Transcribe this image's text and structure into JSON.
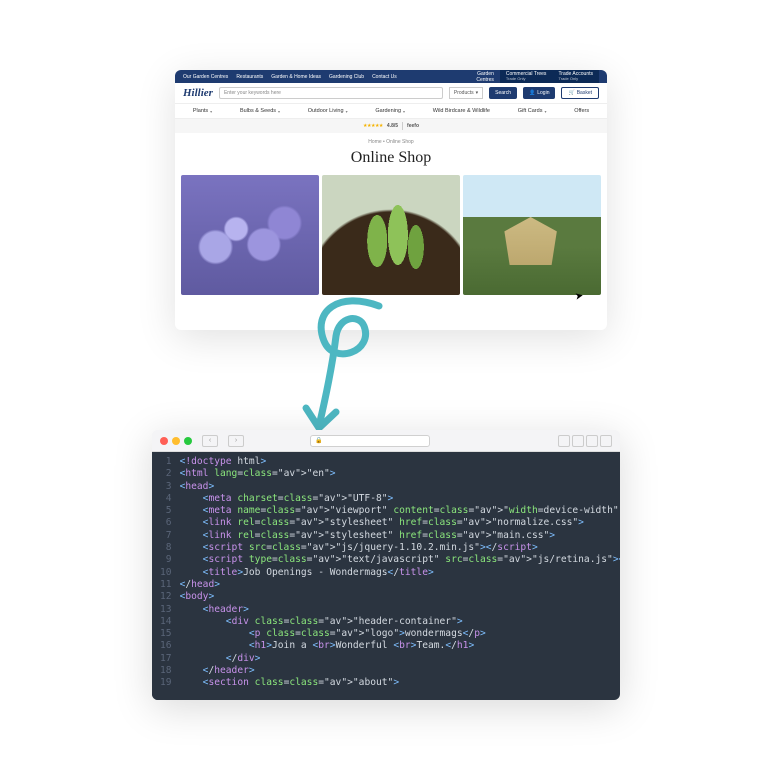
{
  "site": {
    "topbar": {
      "links": [
        "Our Garden Centres",
        "Restaurants",
        "Garden & Home Ideas",
        "Gardening Club",
        "Contact Us"
      ],
      "garden_centres": "Garden\nCentres",
      "commercial": {
        "title": "Commercial Trees",
        "sub": "Trade Only"
      },
      "trade": {
        "title": "Trade Accounts",
        "sub": "Trade Only"
      }
    },
    "logo": "Hillier",
    "search_placeholder": "Enter your keywords here",
    "products_label": "Products",
    "search_btn": "Search",
    "login_btn": "Login",
    "basket_btn": "Basket",
    "catnav": [
      "Plants",
      "Bulbs & Seeds",
      "Outdoor Living",
      "Gardening",
      "Wild Birdcare & Wildlife",
      "Gift Cards",
      "Offers"
    ],
    "rating": {
      "stars": "★★★★★",
      "score": "4.8/5",
      "provider": "feefo"
    },
    "breadcrumb": "Home  •  Online Shop",
    "page_title": "Online Shop"
  },
  "arrow_color": "#4db7c2",
  "editor": {
    "url_lock": "🔒",
    "lines": [
      {
        "n": 1,
        "raw": "<!doctype html>"
      },
      {
        "n": 2,
        "raw": "<html lang=\"en\">"
      },
      {
        "n": 3,
        "raw": "<head>"
      },
      {
        "n": 4,
        "raw": "    <meta charset=\"UTF-8\">"
      },
      {
        "n": 5,
        "raw": "    <meta name=\"viewport\" content=\"width=device-width\" />"
      },
      {
        "n": 6,
        "raw": "    <link rel=\"stylesheet\" href=\"normalize.css\">"
      },
      {
        "n": 7,
        "raw": "    <link rel=\"stylesheet\" href=\"main.css\">"
      },
      {
        "n": 8,
        "raw": "    <script src=\"js/jquery-1.10.2.min.js\"></script>"
      },
      {
        "n": 9,
        "raw": "    <script type=\"text/javascript\" src=\"js/retina.js\"></script>"
      },
      {
        "n": 10,
        "raw": "    <title>Job Openings - Wondermags</title>"
      },
      {
        "n": 11,
        "raw": "</head>"
      },
      {
        "n": 12,
        "raw": "<body>"
      },
      {
        "n": 13,
        "raw": "    <header>"
      },
      {
        "n": 14,
        "raw": "        <div class=\"header-container\">"
      },
      {
        "n": 15,
        "raw": "            <p class=\"logo\">wondermags</p>"
      },
      {
        "n": 16,
        "raw": "            <h1>Join a <br>Wonderful <br>Team.</h1>"
      },
      {
        "n": 17,
        "raw": "        </div>"
      },
      {
        "n": 18,
        "raw": "    </header>"
      },
      {
        "n": 19,
        "raw": "    <section class=\"about\">"
      }
    ]
  }
}
